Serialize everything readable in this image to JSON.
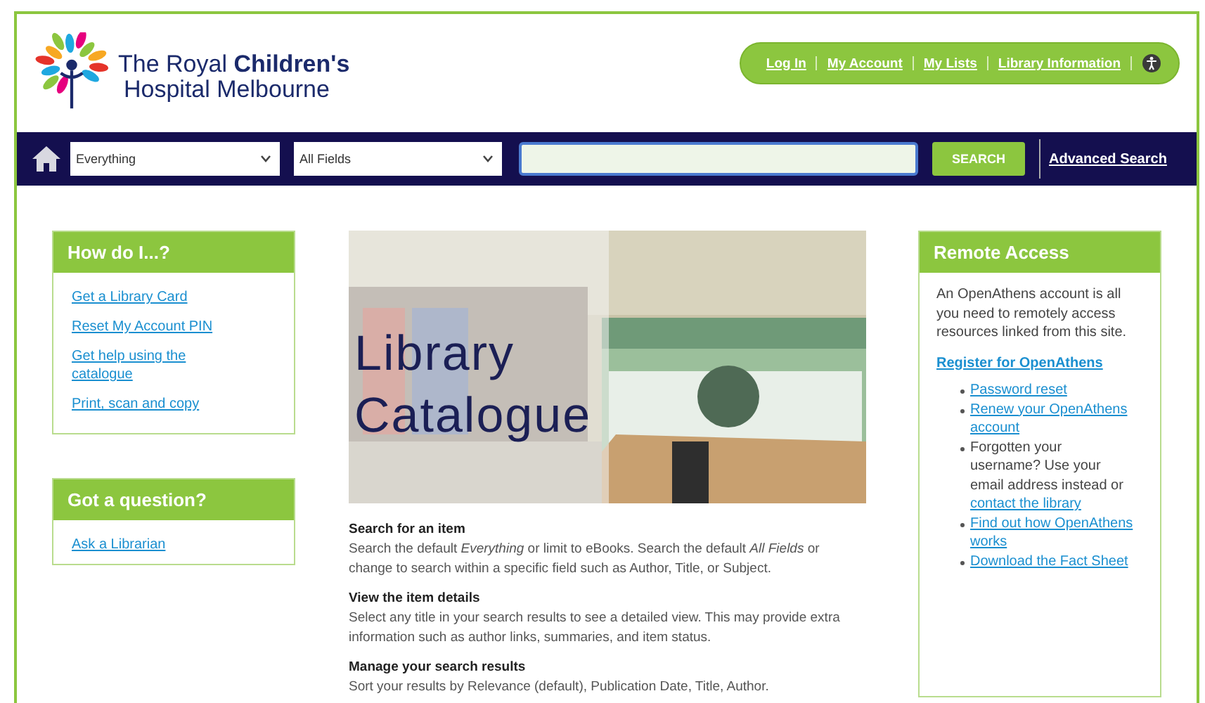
{
  "logo": {
    "line_1": "The Royal **Children's**",
    "line_2": "Hospital Melbourne"
  },
  "top_links": [
    "Log In",
    "My Account",
    "My Lists",
    "Library Information"
  ],
  "search_bar": {
    "scope": "Everything",
    "field": "All Fields",
    "button": "SEARCH",
    "advanced": "Advanced Search"
  },
  "how_do_i": {
    "title": "How do I...?",
    "links": [
      "Get a Library Card",
      "Reset My Account PIN",
      "Get help using the catalogue",
      "Print, scan and copy"
    ]
  },
  "got_a_question": {
    "title": "Got a question?",
    "links": [
      "Ask a Librarian"
    ]
  },
  "banner": {
    "kind": "picture",
    "title_1": "Library",
    "title_2": "Catalogue"
  },
  "help": [
    {
      "heading": "Search for an item",
      "text": "Search the default *Everything* or limit to eBooks. Search the default *All Fields* or change to search within a specific field such as Author, Title, or Subject."
    },
    {
      "heading": "View the item details",
      "text": "Select any title in your search results to see a detailed view. This may provide extra information such as author links, summaries, and item status."
    },
    {
      "heading": "Manage your search results",
      "text": "Sort your results by Relevance (default), Publication Date, Title, Author."
    }
  ],
  "remote_access": {
    "title": "Remote Access",
    "intro": "An OpenAthens account is all you need to remotely access resources linked from this site.",
    "register": "Register for OpenAthens",
    "items": [
      {
        "kind": "link",
        "text": "Password reset"
      },
      {
        "kind": "link",
        "text": "Renew your OpenAthens account"
      },
      {
        "kind": "mixed",
        "text": "Forgotten your username? Use your email address instead or",
        "link": "contact the library"
      },
      {
        "kind": "link",
        "text": "Find out how OpenAthens works"
      },
      {
        "kind": "link",
        "text": "Download the Fact Sheet"
      }
    ]
  }
}
